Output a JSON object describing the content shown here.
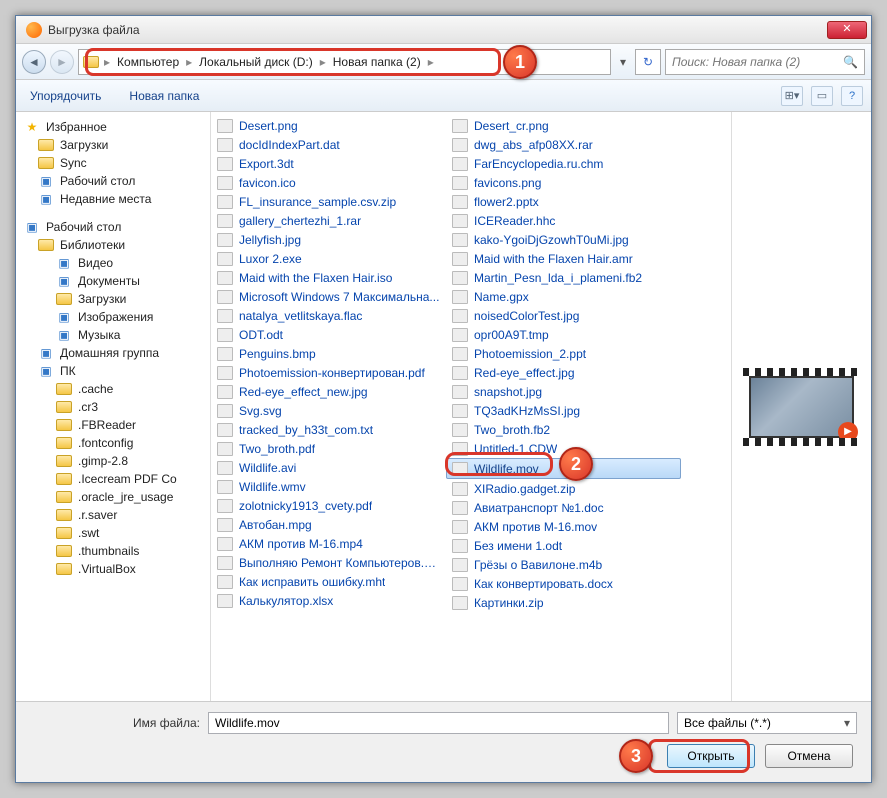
{
  "title": "Выгрузка файла",
  "breadcrumbs": [
    "Компьютер",
    "Локальный диск (D:)",
    "Новая папка (2)"
  ],
  "search_placeholder": "Поиск: Новая папка (2)",
  "toolbar": {
    "organize": "Упорядочить",
    "newfolder": "Новая папка"
  },
  "sidebar": [
    {
      "t": "Избранное",
      "l": 0,
      "i": "star"
    },
    {
      "t": "Загрузки",
      "l": 1,
      "i": "folder"
    },
    {
      "t": "Sync",
      "l": 1,
      "i": "folder"
    },
    {
      "t": "Рабочий стол",
      "l": 1,
      "i": "blue"
    },
    {
      "t": "Недавние места",
      "l": 1,
      "i": "blue"
    },
    {
      "t": "",
      "l": 0,
      "i": "gap"
    },
    {
      "t": "Рабочий стол",
      "l": 0,
      "i": "blue"
    },
    {
      "t": "Библиотеки",
      "l": 1,
      "i": "folder"
    },
    {
      "t": "Видео",
      "l": 2,
      "i": "blue"
    },
    {
      "t": "Документы",
      "l": 2,
      "i": "blue"
    },
    {
      "t": "Загрузки",
      "l": 2,
      "i": "folder"
    },
    {
      "t": "Изображения",
      "l": 2,
      "i": "blue"
    },
    {
      "t": "Музыка",
      "l": 2,
      "i": "blue"
    },
    {
      "t": "Домашняя группа",
      "l": 1,
      "i": "blue"
    },
    {
      "t": "ПК",
      "l": 1,
      "i": "blue"
    },
    {
      "t": ".cache",
      "l": 2,
      "i": "folder"
    },
    {
      "t": ".cr3",
      "l": 2,
      "i": "folder"
    },
    {
      "t": ".FBReader",
      "l": 2,
      "i": "folder"
    },
    {
      "t": ".fontconfig",
      "l": 2,
      "i": "folder"
    },
    {
      "t": ".gimp-2.8",
      "l": 2,
      "i": "folder"
    },
    {
      "t": ".Icecream PDF Co",
      "l": 2,
      "i": "folder"
    },
    {
      "t": ".oracle_jre_usage",
      "l": 2,
      "i": "folder"
    },
    {
      "t": ".r.saver",
      "l": 2,
      "i": "folder"
    },
    {
      "t": ".swt",
      "l": 2,
      "i": "folder"
    },
    {
      "t": ".thumbnails",
      "l": 2,
      "i": "folder"
    },
    {
      "t": ".VirtualBox",
      "l": 2,
      "i": "folder"
    }
  ],
  "files_col1": [
    "Desert.png",
    "docIdIndexPart.dat",
    "Export.3dt",
    "favicon.ico",
    "FL_insurance_sample.csv.zip",
    "gallery_chertezhi_1.rar",
    "Jellyfish.jpg",
    "Luxor 2.exe",
    "Maid with the Flaxen Hair.iso",
    "Microsoft Windows 7 Максимальна...",
    "natalya_vetlitskaya.flac",
    "ODT.odt",
    "Penguins.bmp",
    "Photoemission-конвертирован.pdf",
    "Red-eye_effect_new.jpg",
    "Svg.svg",
    "tracked_by_h33t_com.txt",
    "Two_broth.pdf",
    "Wildlife.avi",
    "Wildlife.wmv",
    "zolotnicky1913_cvety.pdf",
    "Автобан.mpg",
    "АКМ против М-16.mp4",
    "Выполняю Ремонт Компьютеров.png",
    "Как исправить ошибку.mht",
    "Калькулятор.xlsx"
  ],
  "files_col2": [
    "Desert_cr.png",
    "dwg_abs_afp08XX.rar",
    "FarEncyclopedia.ru.chm",
    "favicons.png",
    "flower2.pptx",
    "ICEReader.hhc",
    "kako-YgoiDjGzowhT0uMi.jpg",
    "Maid with the Flaxen Hair.amr",
    "Martin_Pesn_lda_i_plameni.fb2",
    "Name.gpx",
    "noisedColorTest.jpg",
    "opr00A9T.tmp",
    "Photoemission_2.ppt",
    "Red-eye_effect.jpg",
    "snapshot.jpg",
    "TQ3adKHzMsSI.jpg",
    "Two_broth.fb2",
    "Untitled-1.CDW",
    "Wildlife.mov",
    "XIRadio.gadget.zip",
    "Авиатранспорт №1.doc",
    "АКМ против М-16.mov",
    "Без имени 1.odt",
    "Грёзы о Вавилоне.m4b",
    "Как конвертировать.docx",
    "Картинки.zip"
  ],
  "selected_file": "Wildlife.mov",
  "filename_label": "Имя файла:",
  "filename_value": "Wildlife.mov",
  "filter": "Все файлы (*.*)",
  "open_btn": "Открыть",
  "cancel_btn": "Отмена",
  "badges": {
    "1": "1",
    "2": "2",
    "3": "3"
  }
}
